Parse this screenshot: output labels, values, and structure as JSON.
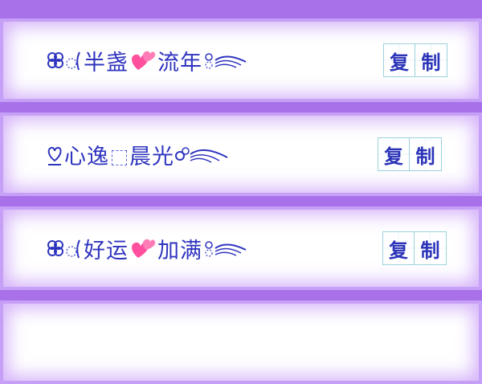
{
  "colors": {
    "background_purple": "#a871ea",
    "card_glow": "#b072f4",
    "text_blue": "#2f34be",
    "heart_pink": "#ff4f9d"
  },
  "cards": [
    {
      "name": "半盏流年",
      "segments": [
        "半盏",
        "流年"
      ],
      "decorations": [
        "clover-icon",
        "circle-dots-icon",
        "heart-icon",
        "wing-icon"
      ],
      "copy_label": [
        "复",
        "制"
      ]
    },
    {
      "name": "心逸晨光",
      "segments": [
        "心逸",
        "晨光"
      ],
      "decorations": [
        "heart-outline-icon",
        "dashed-box-icon",
        "wing-icon"
      ],
      "copy_label": [
        "复",
        "制"
      ]
    },
    {
      "name": "好运加满",
      "segments": [
        "好运",
        "加满"
      ],
      "decorations": [
        "clover-icon",
        "circle-dots-icon",
        "heart-icon",
        "wing-icon"
      ],
      "copy_label": [
        "复",
        "制"
      ]
    }
  ]
}
